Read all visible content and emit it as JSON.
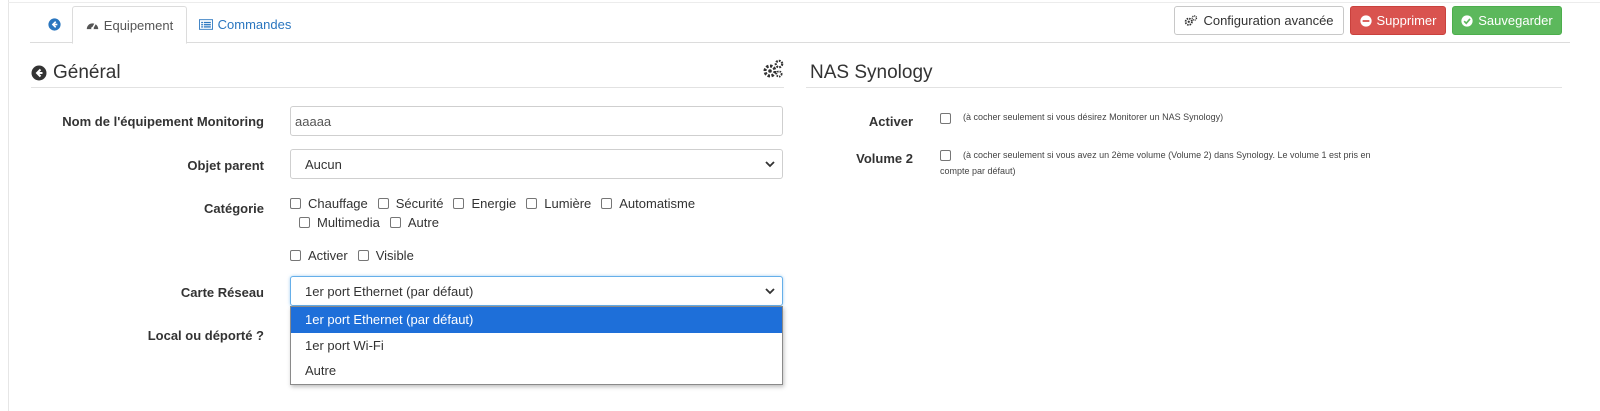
{
  "tabs": {
    "equipement_label": "Equipement",
    "commandes_label": "Commandes"
  },
  "toolbar": {
    "config_label": "Configuration avancée",
    "delete_label": "Supprimer",
    "save_label": "Sauvegarder"
  },
  "general": {
    "title": "Général",
    "name_label": "Nom de l'équipement Monitoring",
    "name_value": "aaaaa",
    "parent_label": "Objet parent",
    "parent_value": "Aucun",
    "category_label": "Catégorie",
    "categories": [
      "Chauffage",
      "Sécurité",
      "Energie",
      "Lumière",
      "Automatisme",
      "Multimedia",
      "Autre"
    ],
    "activer_label": "Activer",
    "visible_label": "Visible",
    "network_label": "Carte Réseau",
    "network_value": "1er port Ethernet (par défaut)",
    "network_options": [
      "1er port Ethernet (par défaut)",
      "1er port Wi-Fi",
      "Autre"
    ],
    "local_label": "Local ou déporté ?"
  },
  "nas": {
    "title": "NAS Synology",
    "activer_label": "Activer",
    "activer_help": "(à cocher seulement si vous désirez Monitorer un NAS Synology)",
    "volume_label": "Volume 2",
    "volume_help_line1": "(à cocher seulement si vous avez un 2ème volume (Volume 2) dans Synology. Le volume 1 est pris en",
    "volume_help_line2": "compte par défaut)"
  },
  "colors": {
    "link": "#2a76bf",
    "danger": "#d9534f",
    "success": "#5cb85c",
    "selected_option": "#1e6fd9"
  }
}
